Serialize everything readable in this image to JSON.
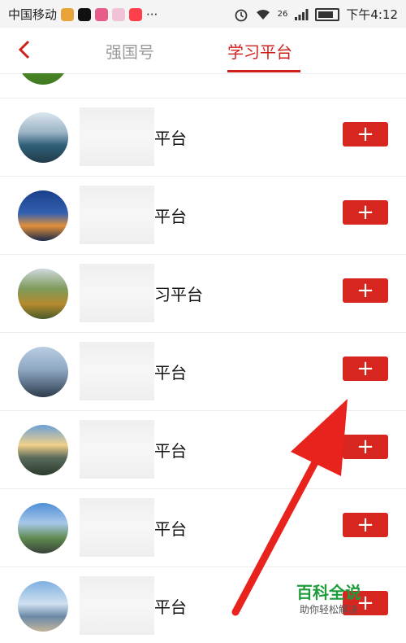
{
  "status_bar": {
    "carrier": "中国移动",
    "dots": "···",
    "signal_label": "26",
    "time": "下午4:12"
  },
  "nav": {
    "back_icon": "chevron-left-icon",
    "tabs": [
      {
        "label": "强国号",
        "active": false
      },
      {
        "label": "学习平台",
        "active": true
      }
    ]
  },
  "list": {
    "rows": [
      {
        "name": "平台",
        "add": "+"
      },
      {
        "name": "平台",
        "add": "+"
      },
      {
        "name": "习平台",
        "add": "+"
      },
      {
        "name": "平台",
        "add": "+"
      },
      {
        "name": "平台",
        "add": "+"
      },
      {
        "name": "平台",
        "add": "+"
      },
      {
        "name": "平台",
        "add": "+"
      }
    ]
  },
  "watermark": {
    "title": "百科全说",
    "subtitle": "助你轻松解决"
  },
  "colors": {
    "accent": "#d0201b",
    "add_button": "#d7261f",
    "arrow": "#e8231d",
    "logo_green": "#1e9c3b"
  }
}
